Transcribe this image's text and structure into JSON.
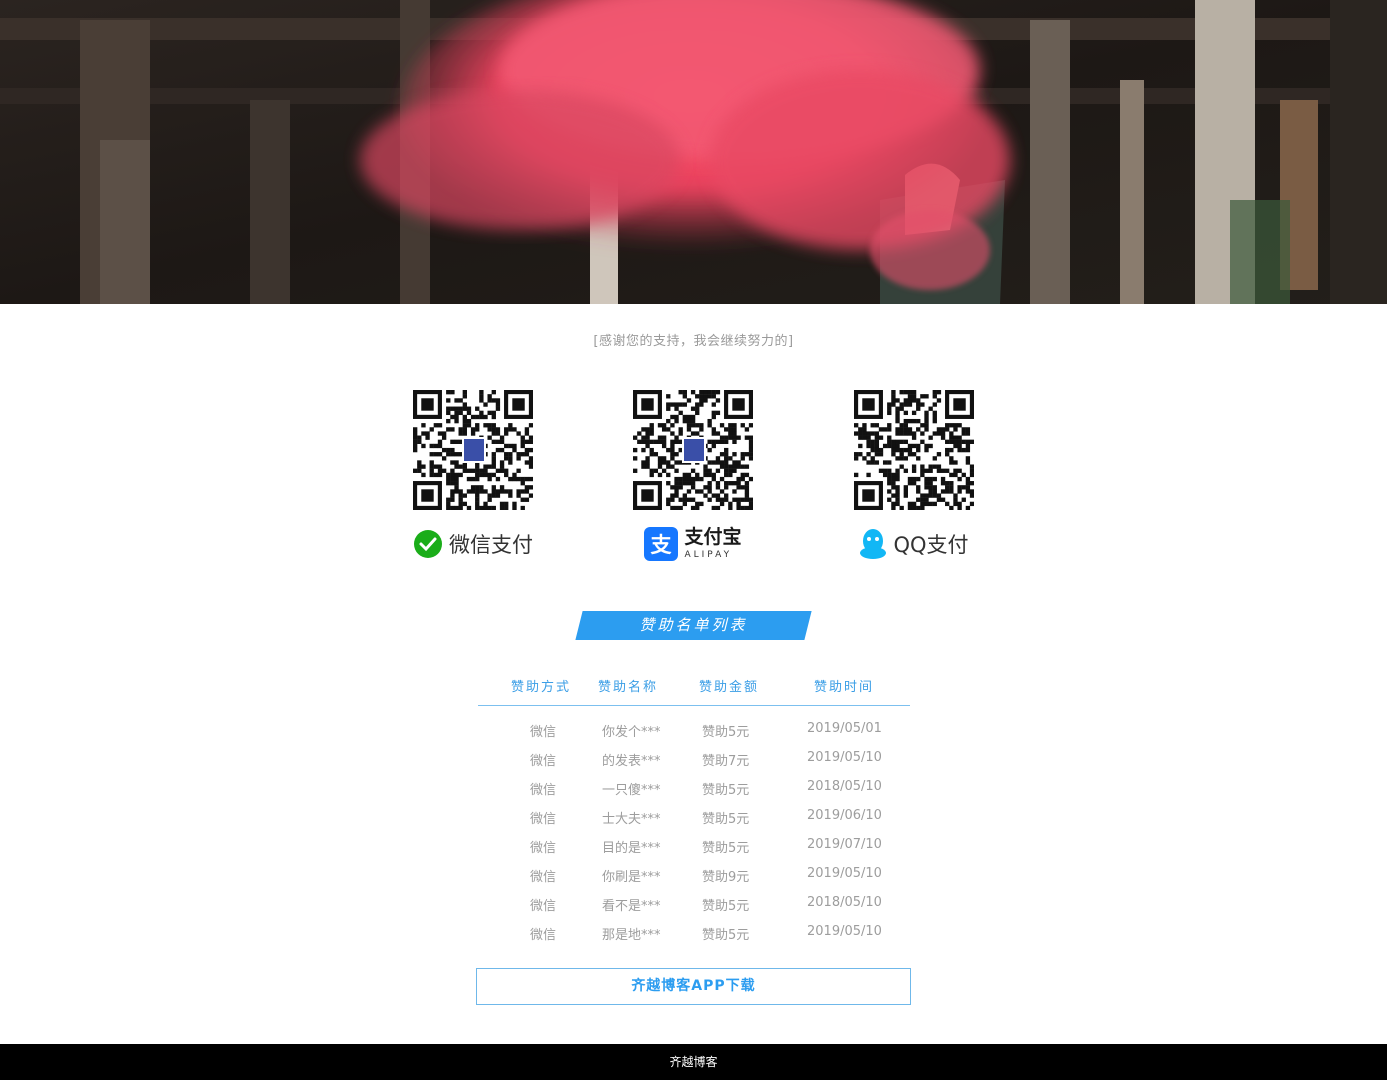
{
  "hero": {
    "image": "photo-person-pink-smoke-under-pier"
  },
  "thanks_text": "[感谢您的支持，我会继续努力的]",
  "payments": [
    {
      "id": "wechat",
      "label": "微信支付",
      "icon": "wechat-pay-icon",
      "color": "#1aad19"
    },
    {
      "id": "alipay",
      "label": "支付宝",
      "sublabel": "ALIPAY",
      "icon": "alipay-icon",
      "color": "#1677ff"
    },
    {
      "id": "qq",
      "label": "QQ支付",
      "icon": "qq-penguin-icon",
      "color": "#12b7f5"
    }
  ],
  "sponsor_list": {
    "title": "赞助名单列表",
    "columns": [
      "赞助方式",
      "赞助名称",
      "赞助金额",
      "赞助时间"
    ],
    "rows": [
      [
        "微信",
        "你发个***",
        "赞助5元",
        "2019/05/01"
      ],
      [
        "微信",
        "的发表***",
        "赞助7元",
        "2019/05/10"
      ],
      [
        "微信",
        "一只傻***",
        "赞助5元",
        "2018/05/10"
      ],
      [
        "微信",
        "士大夫***",
        "赞助5元",
        "2019/06/10"
      ],
      [
        "微信",
        "目的是***",
        "赞助5元",
        "2019/07/10"
      ],
      [
        "微信",
        "你刷是***",
        "赞助9元",
        "2019/05/10"
      ],
      [
        "微信",
        "看不是***",
        "赞助5元",
        "2018/05/10"
      ],
      [
        "微信",
        "那是地***",
        "赞助5元",
        "2019/05/10"
      ]
    ]
  },
  "app_button": "齐越博客APP下载",
  "footer": "齐越博客",
  "colors": {
    "accent": "#2c9df0",
    "footer_bg": "#000000",
    "muted_text": "#9d9d9d"
  }
}
